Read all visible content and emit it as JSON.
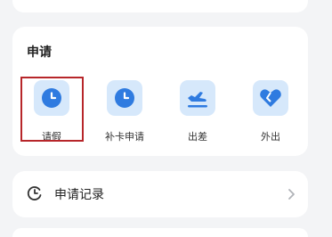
{
  "apply_section": {
    "title": "申请",
    "items": [
      {
        "label": "请假",
        "icon": "clock-icon"
      },
      {
        "label": "补卡申请",
        "icon": "clock-icon"
      },
      {
        "label": "出差",
        "icon": "airplane-icon"
      },
      {
        "label": "外出",
        "icon": "heart-icon"
      }
    ]
  },
  "records": {
    "label": "申请记录",
    "icon": "history-icon"
  },
  "colors": {
    "accent": "#2f7be0",
    "icon_bg": "#d6e8fb",
    "highlight": "#b7262a"
  }
}
